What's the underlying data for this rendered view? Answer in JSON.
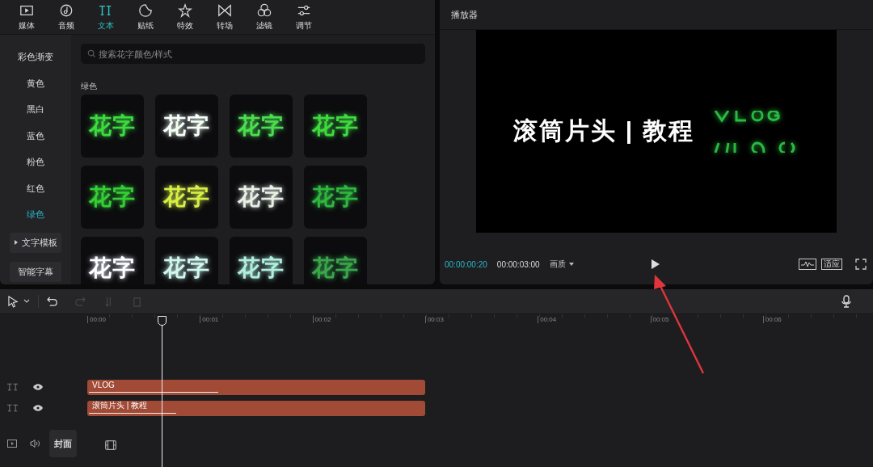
{
  "tabs": [
    {
      "label": "媒体",
      "selected": false
    },
    {
      "label": "音频",
      "selected": false
    },
    {
      "label": "文本",
      "selected": true
    },
    {
      "label": "贴纸",
      "selected": false
    },
    {
      "label": "特效",
      "selected": false
    },
    {
      "label": "转场",
      "selected": false
    },
    {
      "label": "滤镜",
      "selected": false
    },
    {
      "label": "调节",
      "selected": false
    }
  ],
  "sidebar": {
    "items": [
      {
        "label": "彩色渐变",
        "selected": false
      },
      {
        "label": "黄色",
        "selected": false
      },
      {
        "label": "黑白",
        "selected": false
      },
      {
        "label": "蓝色",
        "selected": false
      },
      {
        "label": "粉色",
        "selected": false
      },
      {
        "label": "红色",
        "selected": false
      },
      {
        "label": "绿色",
        "selected": true
      }
    ],
    "buttons": [
      {
        "label": "文字模板",
        "kind": "group"
      },
      {
        "label": "智能字幕",
        "kind": "button"
      }
    ]
  },
  "search": {
    "placeholder": "搜索花字颜色/样式"
  },
  "section_title": "绿色",
  "styles": [
    {
      "label": "花字",
      "color": "#3ddc3a"
    },
    {
      "label": "花字",
      "color": "#f4fff0"
    },
    {
      "label": "花字",
      "color": "#4be04a"
    },
    {
      "label": "花字",
      "color": "#3fdc3a"
    },
    {
      "label": "花字",
      "color": "#35d030"
    },
    {
      "label": "花字",
      "color": "#d8f040"
    },
    {
      "label": "花字",
      "color": "#e8f0e0"
    },
    {
      "label": "花字",
      "color": "#2fb83a"
    },
    {
      "label": "花字",
      "color": "#ffffff"
    },
    {
      "label": "花字",
      "color": "#d0f8e8"
    },
    {
      "label": "花字",
      "color": "#b0f0d8"
    },
    {
      "label": "花字",
      "color": "#3aa846"
    }
  ],
  "player": {
    "title": "播放器",
    "preview_text": "滚筒片头 | 教程",
    "current_time": "00:00:00:20",
    "total_time": "00:00:03:00",
    "quality_label": "画质",
    "fit_label": "适应"
  },
  "timeline": {
    "ruler": [
      "00:00",
      "00:01",
      "00:02",
      "00:03",
      "00:04",
      "00:05",
      "00:06"
    ],
    "tracks": [
      {
        "kind": "text",
        "clip": "VLOG",
        "visible": true
      },
      {
        "kind": "text",
        "clip": "滚筒片头 | 教程",
        "visible": true
      }
    ],
    "cover_label": "封面"
  }
}
